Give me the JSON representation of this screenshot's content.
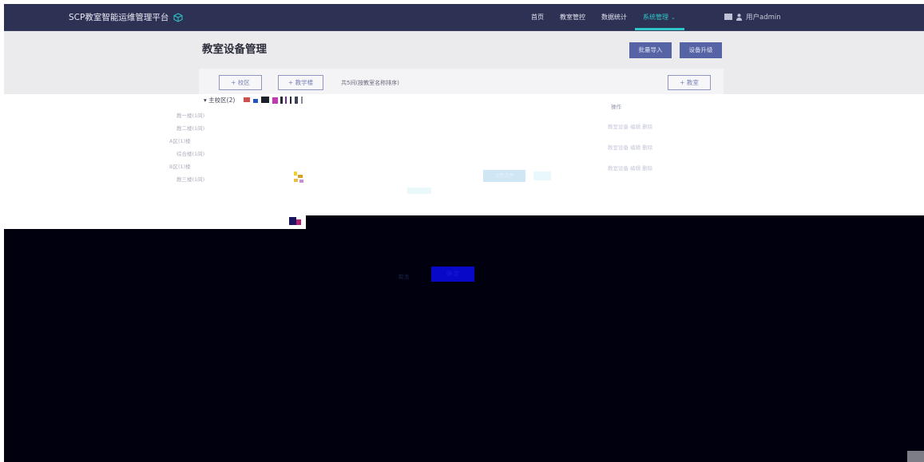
{
  "app": {
    "title": "SCP教室智能运维管理平台",
    "colors": {
      "nav_bg": "#2d3154",
      "accent": "#2ec7c9",
      "primary": "#5663a5",
      "overlay": "#01000f"
    }
  },
  "nav": {
    "items": [
      {
        "label": "首页"
      },
      {
        "label": "教室管控"
      },
      {
        "label": "数据统计"
      },
      {
        "label": "系统管理",
        "active": true
      }
    ],
    "user_label": "用户admin"
  },
  "page": {
    "title": "教室设备管理",
    "batch_import": "批量导入",
    "device_upgrade": "设备升级"
  },
  "toolbar": {
    "add_campus": "+ 校区",
    "add_building": "+ 教学楼",
    "room_count": "共5间(按教室名称排序)",
    "add_classroom": "+ 教室"
  },
  "tree": {
    "root": "主校区(2)",
    "items": [
      "教一楼(1间)",
      "教二楼(1间)",
      "A区(1)楼",
      "综合楼(1间)",
      "B区(1)楼",
      "教三楼(1间)"
    ]
  },
  "table": {
    "op_header": "操作",
    "op_rows": [
      "教室设备 编辑 删除",
      "教室设备 编辑 删除",
      "教室设备 编辑 删除"
    ]
  },
  "dialog": {
    "cancel": "取消",
    "confirm": "确 定",
    "ghost_button": "上传文件"
  }
}
